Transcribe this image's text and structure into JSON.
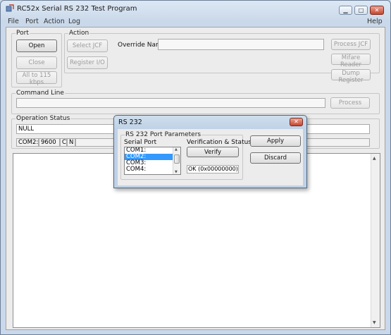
{
  "window": {
    "title": "RC52x Serial RS 232 Test Program",
    "minimize_glyph": "▁",
    "maximize_glyph": "□",
    "close_glyph": "✕",
    "app_icon": "rc52x-app-icon"
  },
  "menu": {
    "items": [
      "File",
      "Port",
      "Action",
      "Log"
    ],
    "help": "Help"
  },
  "port_group": {
    "title": "Port",
    "open": "Open",
    "close": "Close",
    "all_baud": "All to 115 kbps"
  },
  "action_group": {
    "title": "Action",
    "select_jcf": "Select JCF",
    "register_io": "Register I/O",
    "override_label": "Override Name:",
    "override_value": ""
  },
  "right_buttons": {
    "process_jcf": "Process JCF",
    "mifare_reader": "Mifare Reader",
    "dump_register": "Dump Register"
  },
  "command_line": {
    "title": "Command Line",
    "value": "",
    "process": "Process"
  },
  "operation_status": {
    "title": "Operation Status",
    "status_value": "NULL",
    "port": "COM2:",
    "baud": "9600",
    "flag1": "C",
    "flag2": "N"
  },
  "dialog": {
    "title": "RS 232",
    "close_glyph": "✕",
    "params_title": "RS 232 Port Parameters",
    "serial_port_label": "Serial Port",
    "ports": [
      "COM1:",
      "COM2:",
      "COM3:",
      "COM4:"
    ],
    "selected_port": "COM2:",
    "verification_label": "Verification & Status",
    "verify": "Verify",
    "status_value": "OK (0x00000000)",
    "apply": "Apply",
    "discard": "Discard"
  },
  "colors": {
    "selection": "#3399ff",
    "close_button": "#c8462f"
  }
}
